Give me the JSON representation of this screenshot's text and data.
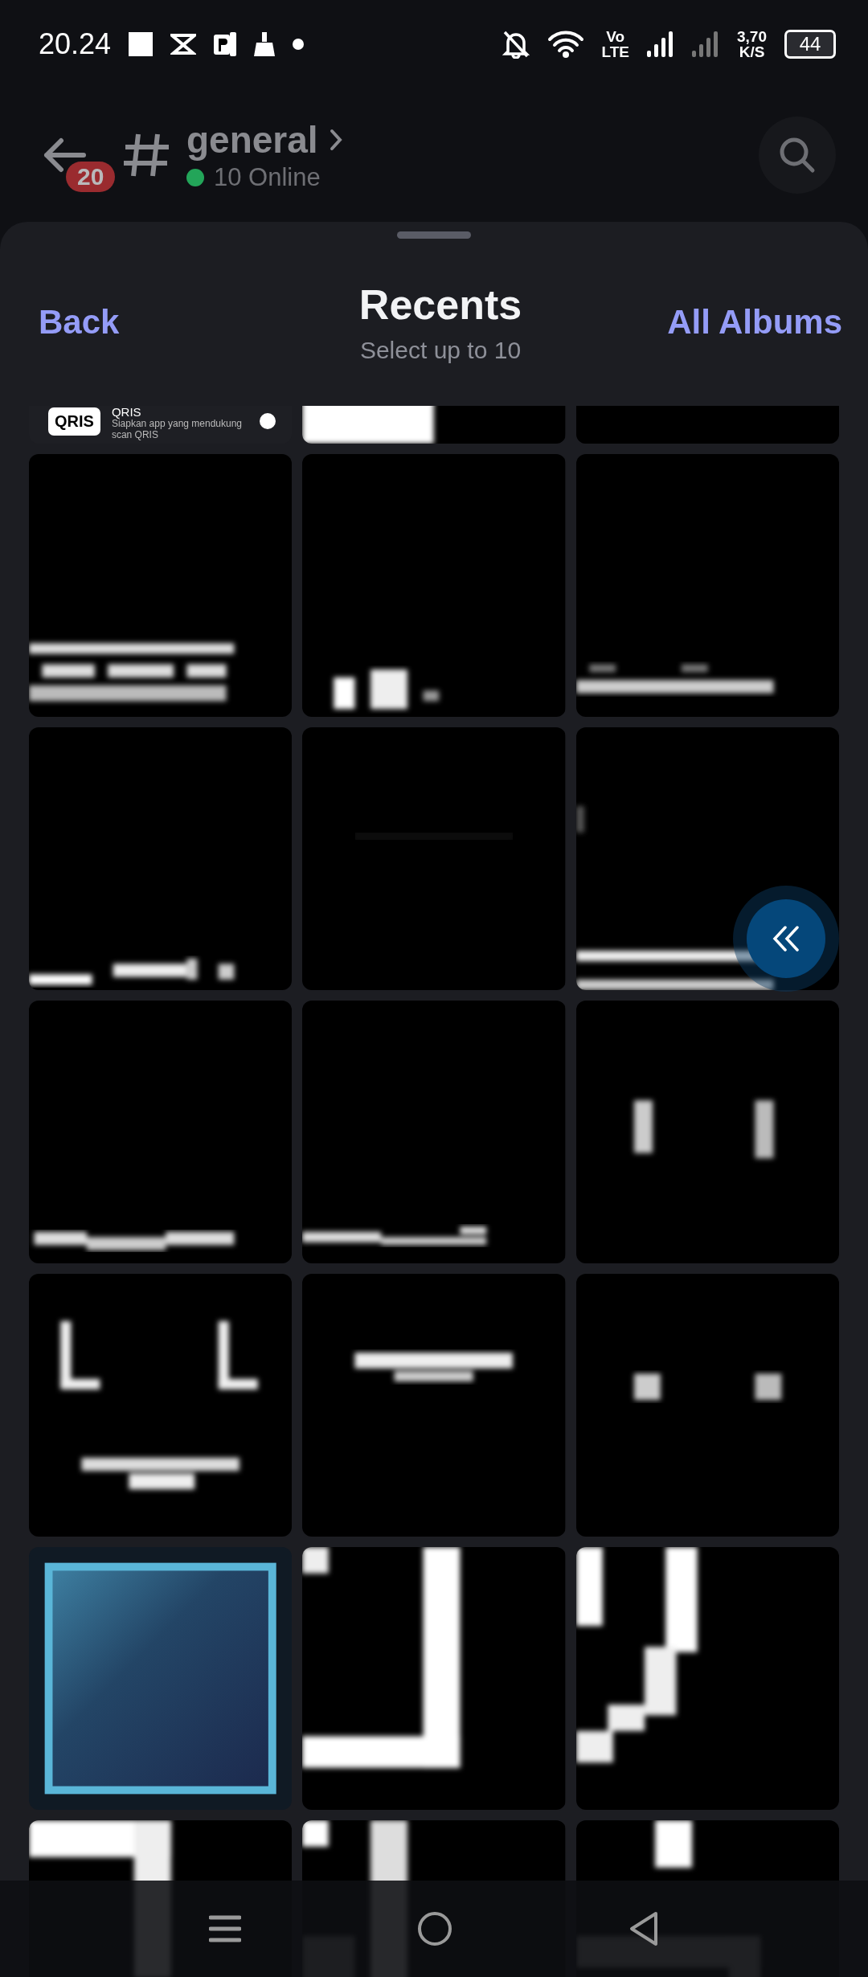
{
  "status_bar": {
    "time": "20.24",
    "network_top": "Vo",
    "network_bottom": "LTE",
    "speed_value": "3,70",
    "speed_unit": "K/S",
    "battery": "44"
  },
  "channel_header": {
    "unread_badge": "20",
    "channel_name": "general",
    "online_count": "10 Online"
  },
  "sheet": {
    "back": "Back",
    "title": "Recents",
    "subtitle": "Select up to 10",
    "all_albums": "All Albums"
  },
  "photos": [
    {
      "kind": "screenshot",
      "logo": "QRIS",
      "title": "QRIS",
      "caption": "Siapkan app yang mendukung scan QRIS"
    },
    {
      "kind": "picture"
    },
    {
      "kind": "picture"
    },
    {
      "kind": "picture"
    },
    {
      "kind": "picture"
    },
    {
      "kind": "picture"
    },
    {
      "kind": "picture"
    },
    {
      "kind": "picture"
    },
    {
      "kind": "picture"
    },
    {
      "kind": "picture"
    },
    {
      "kind": "picture"
    },
    {
      "kind": "picture"
    },
    {
      "kind": "picture"
    },
    {
      "kind": "picture"
    },
    {
      "kind": "picture"
    },
    {
      "kind": "picture"
    },
    {
      "kind": "picture"
    },
    {
      "kind": "picture"
    },
    {
      "kind": "picture"
    },
    {
      "kind": "picture"
    },
    {
      "kind": "picture"
    }
  ]
}
